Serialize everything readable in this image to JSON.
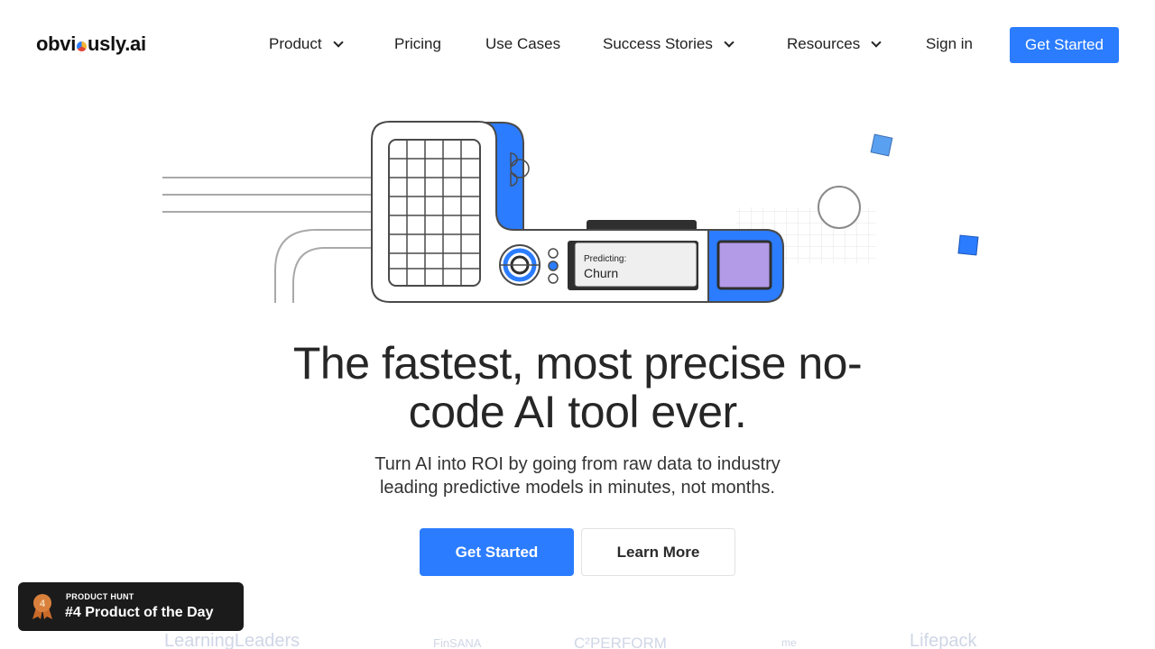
{
  "brand": {
    "logo_before": "obvi",
    "logo_after": "usly.ai",
    "colors": {
      "primary": "#2b7cff",
      "purple": "#b39be8",
      "dark": "#1b1b1b"
    }
  },
  "nav": {
    "items": [
      {
        "label": "Product",
        "has_dropdown": true
      },
      {
        "label": "Pricing",
        "has_dropdown": false
      },
      {
        "label": "Use Cases",
        "has_dropdown": false
      },
      {
        "label": "Success Stories",
        "has_dropdown": true
      },
      {
        "label": "Resources",
        "has_dropdown": true
      }
    ],
    "sign_in": "Sign in",
    "cta": "Get Started"
  },
  "illustration": {
    "screen_label": "Predicting:",
    "screen_value": "Churn"
  },
  "hero": {
    "headline_line1": "The fastest, most precise no-",
    "headline_line2": "code AI tool ever.",
    "subtitle_line1": "Turn AI into ROI by going from raw data to industry",
    "subtitle_line2": "leading predictive models in minutes, not months.",
    "primary_cta": "Get Started",
    "secondary_cta": "Learn More"
  },
  "product_hunt": {
    "rank": "4",
    "kicker": "PRODUCT HUNT",
    "title": "#4 Product of the Day"
  },
  "client_logos": [
    {
      "name": "LearningLeaders"
    },
    {
      "name": "FinSANA"
    },
    {
      "name": "C²PERFORM"
    },
    {
      "name": "me"
    },
    {
      "name": "Lifepack"
    }
  ]
}
